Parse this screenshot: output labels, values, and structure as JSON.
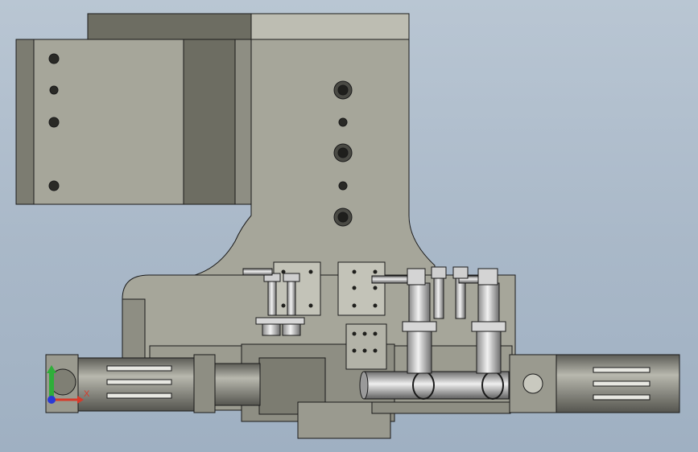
{
  "viewport": {
    "background_top": "#b9c6d3",
    "background_bottom": "#9fb0c2"
  },
  "model": {
    "body_color": "#a6a69a",
    "shadow_color": "#6d6d62",
    "light_color": "#c9c9bf",
    "edge_color": "#1a1a1a",
    "metal_color": "#d7d7d7"
  },
  "triad": {
    "x_label": "X",
    "x_color": "#d63a2a",
    "y_color": "#2fae3a",
    "z_color": "#2a39d6"
  }
}
